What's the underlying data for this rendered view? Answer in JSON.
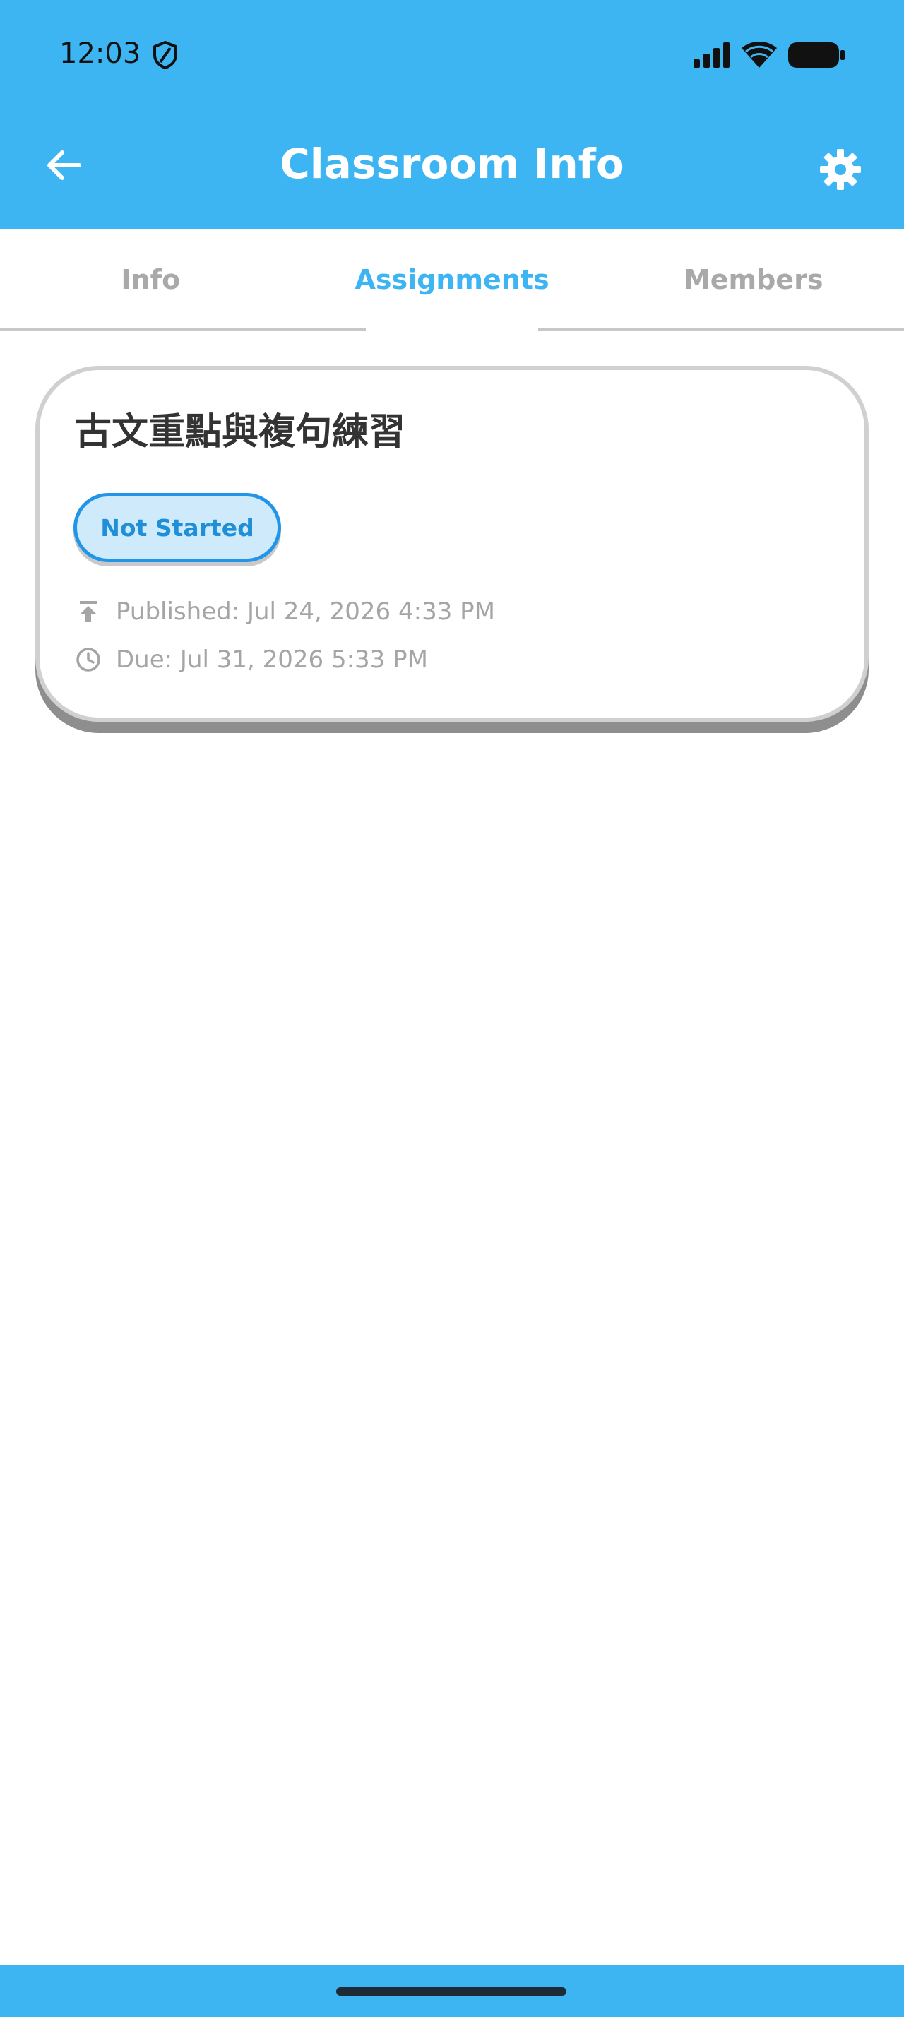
{
  "status_bar": {
    "time": "12:03",
    "icons": [
      "shield-icon",
      "signal-icon",
      "wifi-icon",
      "battery-icon"
    ]
  },
  "app_bar": {
    "title": "Classroom Info",
    "back_icon": "arrow-left-icon",
    "settings_icon": "gear-icon"
  },
  "tabs": [
    {
      "label": "Info",
      "active": false
    },
    {
      "label": "Assignments",
      "active": true
    },
    {
      "label": "Members",
      "active": false
    }
  ],
  "assignments": [
    {
      "title": "古文重點與複句練習",
      "status": "Not Started",
      "published": "Published: Jul 24, 2026 4:33 PM",
      "due": "Due: Jul 31, 2026 5:33 PM",
      "published_icon": "upload-icon",
      "due_icon": "clock-icon"
    }
  ],
  "colors": {
    "primary": "#3DB5F2",
    "badge_border": "#2196E8",
    "badge_fill": "#CFEBFB",
    "muted_text": "#A5A5A5",
    "title_text": "#333333"
  }
}
